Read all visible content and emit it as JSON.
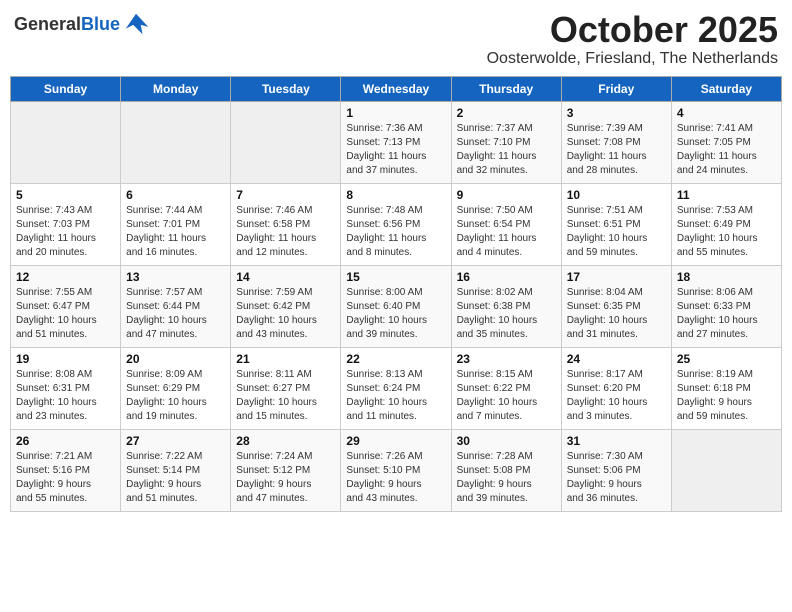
{
  "logo": {
    "general": "General",
    "blue": "Blue"
  },
  "title": "October 2025",
  "subtitle": "Oosterwolde, Friesland, The Netherlands",
  "days_of_week": [
    "Sunday",
    "Monday",
    "Tuesday",
    "Wednesday",
    "Thursday",
    "Friday",
    "Saturday"
  ],
  "weeks": [
    [
      {
        "day": "",
        "info": ""
      },
      {
        "day": "",
        "info": ""
      },
      {
        "day": "",
        "info": ""
      },
      {
        "day": "1",
        "info": "Sunrise: 7:36 AM\nSunset: 7:13 PM\nDaylight: 11 hours\nand 37 minutes."
      },
      {
        "day": "2",
        "info": "Sunrise: 7:37 AM\nSunset: 7:10 PM\nDaylight: 11 hours\nand 32 minutes."
      },
      {
        "day": "3",
        "info": "Sunrise: 7:39 AM\nSunset: 7:08 PM\nDaylight: 11 hours\nand 28 minutes."
      },
      {
        "day": "4",
        "info": "Sunrise: 7:41 AM\nSunset: 7:05 PM\nDaylight: 11 hours\nand 24 minutes."
      }
    ],
    [
      {
        "day": "5",
        "info": "Sunrise: 7:43 AM\nSunset: 7:03 PM\nDaylight: 11 hours\nand 20 minutes."
      },
      {
        "day": "6",
        "info": "Sunrise: 7:44 AM\nSunset: 7:01 PM\nDaylight: 11 hours\nand 16 minutes."
      },
      {
        "day": "7",
        "info": "Sunrise: 7:46 AM\nSunset: 6:58 PM\nDaylight: 11 hours\nand 12 minutes."
      },
      {
        "day": "8",
        "info": "Sunrise: 7:48 AM\nSunset: 6:56 PM\nDaylight: 11 hours\nand 8 minutes."
      },
      {
        "day": "9",
        "info": "Sunrise: 7:50 AM\nSunset: 6:54 PM\nDaylight: 11 hours\nand 4 minutes."
      },
      {
        "day": "10",
        "info": "Sunrise: 7:51 AM\nSunset: 6:51 PM\nDaylight: 10 hours\nand 59 minutes."
      },
      {
        "day": "11",
        "info": "Sunrise: 7:53 AM\nSunset: 6:49 PM\nDaylight: 10 hours\nand 55 minutes."
      }
    ],
    [
      {
        "day": "12",
        "info": "Sunrise: 7:55 AM\nSunset: 6:47 PM\nDaylight: 10 hours\nand 51 minutes."
      },
      {
        "day": "13",
        "info": "Sunrise: 7:57 AM\nSunset: 6:44 PM\nDaylight: 10 hours\nand 47 minutes."
      },
      {
        "day": "14",
        "info": "Sunrise: 7:59 AM\nSunset: 6:42 PM\nDaylight: 10 hours\nand 43 minutes."
      },
      {
        "day": "15",
        "info": "Sunrise: 8:00 AM\nSunset: 6:40 PM\nDaylight: 10 hours\nand 39 minutes."
      },
      {
        "day": "16",
        "info": "Sunrise: 8:02 AM\nSunset: 6:38 PM\nDaylight: 10 hours\nand 35 minutes."
      },
      {
        "day": "17",
        "info": "Sunrise: 8:04 AM\nSunset: 6:35 PM\nDaylight: 10 hours\nand 31 minutes."
      },
      {
        "day": "18",
        "info": "Sunrise: 8:06 AM\nSunset: 6:33 PM\nDaylight: 10 hours\nand 27 minutes."
      }
    ],
    [
      {
        "day": "19",
        "info": "Sunrise: 8:08 AM\nSunset: 6:31 PM\nDaylight: 10 hours\nand 23 minutes."
      },
      {
        "day": "20",
        "info": "Sunrise: 8:09 AM\nSunset: 6:29 PM\nDaylight: 10 hours\nand 19 minutes."
      },
      {
        "day": "21",
        "info": "Sunrise: 8:11 AM\nSunset: 6:27 PM\nDaylight: 10 hours\nand 15 minutes."
      },
      {
        "day": "22",
        "info": "Sunrise: 8:13 AM\nSunset: 6:24 PM\nDaylight: 10 hours\nand 11 minutes."
      },
      {
        "day": "23",
        "info": "Sunrise: 8:15 AM\nSunset: 6:22 PM\nDaylight: 10 hours\nand 7 minutes."
      },
      {
        "day": "24",
        "info": "Sunrise: 8:17 AM\nSunset: 6:20 PM\nDaylight: 10 hours\nand 3 minutes."
      },
      {
        "day": "25",
        "info": "Sunrise: 8:19 AM\nSunset: 6:18 PM\nDaylight: 9 hours\nand 59 minutes."
      }
    ],
    [
      {
        "day": "26",
        "info": "Sunrise: 7:21 AM\nSunset: 5:16 PM\nDaylight: 9 hours\nand 55 minutes."
      },
      {
        "day": "27",
        "info": "Sunrise: 7:22 AM\nSunset: 5:14 PM\nDaylight: 9 hours\nand 51 minutes."
      },
      {
        "day": "28",
        "info": "Sunrise: 7:24 AM\nSunset: 5:12 PM\nDaylight: 9 hours\nand 47 minutes."
      },
      {
        "day": "29",
        "info": "Sunrise: 7:26 AM\nSunset: 5:10 PM\nDaylight: 9 hours\nand 43 minutes."
      },
      {
        "day": "30",
        "info": "Sunrise: 7:28 AM\nSunset: 5:08 PM\nDaylight: 9 hours\nand 39 minutes."
      },
      {
        "day": "31",
        "info": "Sunrise: 7:30 AM\nSunset: 5:06 PM\nDaylight: 9 hours\nand 36 minutes."
      },
      {
        "day": "",
        "info": ""
      }
    ]
  ]
}
